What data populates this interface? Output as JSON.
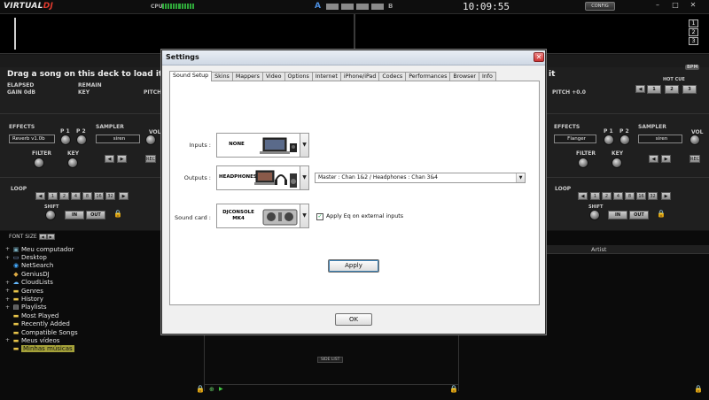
{
  "app": {
    "logo_main": "VIRTUAL",
    "logo_dj": "DJ",
    "cpu_label": "CPU",
    "crossfader_a": "A",
    "crossfader_b": "B",
    "clock": "10:09:55",
    "config_label": "CONFIG"
  },
  "deck_numbers": [
    "1",
    "2",
    "3"
  ],
  "deck_left": {
    "title": "Drag a song on this deck to load it",
    "elapsed_label": "ELAPSED",
    "remain_label": "REMAIN",
    "gain_label": "GAIN 0dB",
    "key_label": "KEY",
    "pitch_label": "PITCH",
    "effects_label": "EFFECTS",
    "effect_value": "Reverb v1.0b",
    "p1_label": "P 1",
    "p2_label": "P 2",
    "sampler_label": "SAMPLER",
    "sampler_value": "siren",
    "vol_label": "VOL",
    "rec_label": "REC",
    "filter_label": "FILTER",
    "key_knob_label": "KEY",
    "loop_label": "LOOP",
    "loop_sizes": [
      "1",
      "2",
      "4",
      "8",
      "16",
      "32"
    ],
    "shift_label": "SHIFT",
    "in_label": "IN",
    "out_label": "OUT"
  },
  "deck_right": {
    "title_tail": "it",
    "pitch_label": "PITCH +0.0",
    "bpm_label": "BPM",
    "hot_cue_label": "HOT CUE",
    "hot_cues": [
      "1",
      "2",
      "3"
    ],
    "effects_label": "EFFECTS",
    "effect_value": "Flanger",
    "p1_label": "P 1",
    "p2_label": "P 2",
    "sampler_label": "SAMPLER",
    "sampler_value": "siren",
    "vol_label": "VOL",
    "rec_label": "REC",
    "filter_label": "FILTER",
    "key_knob_label": "KEY",
    "loop_label": "LOOP",
    "loop_sizes": [
      "1",
      "2",
      "4",
      "8",
      "16",
      "32"
    ],
    "shift_label": "SHIFT",
    "in_label": "IN",
    "out_label": "OUT"
  },
  "browser": {
    "font_size_label": "FONT SIZE",
    "tree": [
      {
        "label": "Meu computador",
        "expand": "+",
        "icon": "computer-icon"
      },
      {
        "label": "Desktop",
        "expand": "+",
        "icon": "desktop-icon"
      },
      {
        "label": "NetSearch",
        "expand": "",
        "icon": "netsearch-icon"
      },
      {
        "label": "GeniusDJ",
        "expand": "",
        "icon": "genius-icon"
      },
      {
        "label": "CloudLists",
        "expand": "+",
        "icon": "cloud-icon"
      },
      {
        "label": "Genres",
        "expand": "+",
        "icon": "folder-icon"
      },
      {
        "label": "History",
        "expand": "+",
        "icon": "folder-icon"
      },
      {
        "label": "Playlists",
        "expand": "+",
        "icon": "playlist-icon"
      },
      {
        "label": "Most Played",
        "expand": "",
        "icon": "folder-icon"
      },
      {
        "label": "Recently Added",
        "expand": "",
        "icon": "folder-icon"
      },
      {
        "label": "Compatible Songs",
        "expand": "",
        "icon": "folder-icon"
      },
      {
        "label": "Meus vídeos",
        "expand": "+",
        "icon": "folder-icon"
      },
      {
        "label": "Minhas músicas",
        "expand": "",
        "icon": "folder-icon",
        "selected": true
      }
    ],
    "artist_header": "Artist",
    "side_list_label": "SIDE LIST"
  },
  "dialog": {
    "title": "Settings",
    "close_label": "✕",
    "tabs": [
      "Sound Setup",
      "Skins",
      "Mappers",
      "Video",
      "Options",
      "Internet",
      "iPhone/iPad",
      "Codecs",
      "Performances",
      "Browser",
      "Info"
    ],
    "active_tab": "Sound Setup",
    "inputs_label": "Inputs :",
    "inputs_value": "NONE",
    "outputs_label": "Outputs :",
    "outputs_value": "HEADPHONES",
    "output_routing": "Master : Chan 1&2 / Headphones : Chan 3&4",
    "soundcard_label": "Sound card :",
    "soundcard_value_line1": "DJCONSOLE",
    "soundcard_value_line2": "MK4",
    "apply_eq_label": "Apply Eq on external inputs",
    "apply_eq_checked": true,
    "apply_label": "Apply",
    "ok_label": "OK"
  }
}
